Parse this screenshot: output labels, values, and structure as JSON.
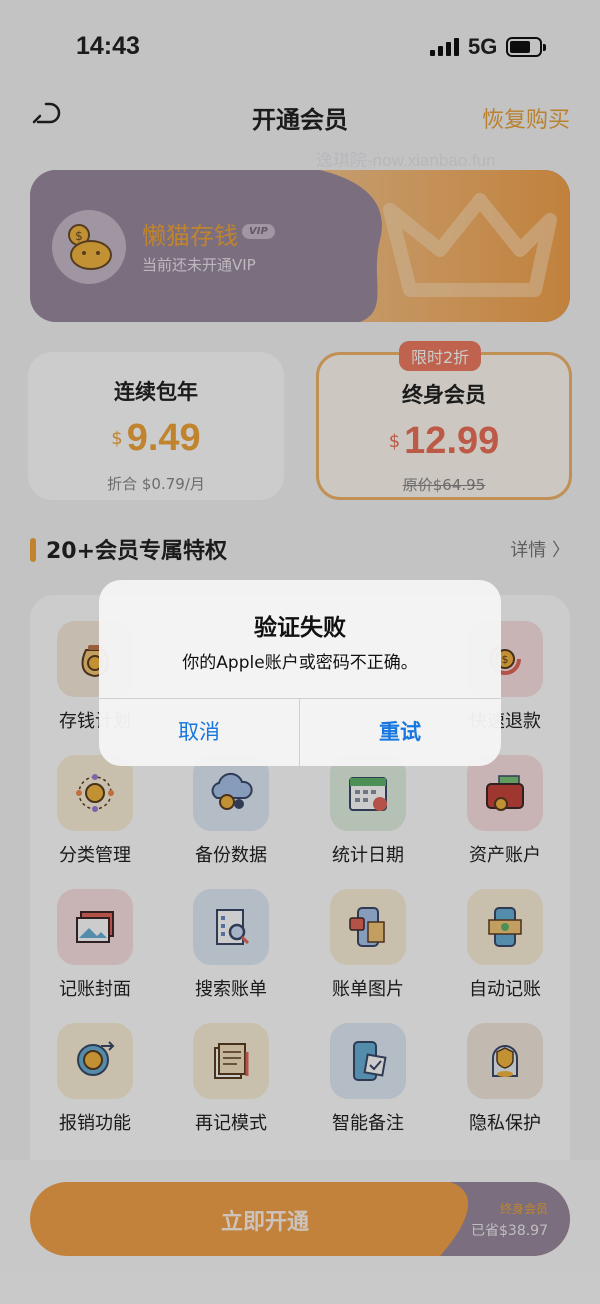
{
  "status_bar": {
    "time": "14:43",
    "network": "5G"
  },
  "nav": {
    "title": "开通会员",
    "restore": "恢复购买"
  },
  "watermark": "逸琪院-now.xianbao.fun",
  "profile": {
    "name": "懒猫存钱",
    "vip_tag": "VIP",
    "status": "当前还未开通VIP"
  },
  "plans": {
    "yearly": {
      "name": "连续包年",
      "currency": "$",
      "price": "9.49",
      "note": "折合 $0.79/月"
    },
    "lifetime": {
      "badge": "限时2折",
      "name": "终身会员",
      "currency": "$",
      "price": "12.99",
      "original": "原价$64.95"
    }
  },
  "privileges": {
    "title": "20+会员专属特权",
    "more": "详情 〉",
    "items": [
      {
        "label": "存钱计划",
        "icon": "coin-bag-icon",
        "bg": "#f7eadb"
      },
      {
        "label": "",
        "icon": "",
        "bg": ""
      },
      {
        "label": "",
        "icon": "",
        "bg": ""
      },
      {
        "label": "快速退款",
        "icon": "refund-coin-icon",
        "bg": "#fbe1e1"
      },
      {
        "label": "分类管理",
        "icon": "category-coin-icon",
        "bg": "#fbf0d7"
      },
      {
        "label": "备份数据",
        "icon": "cloud-backup-icon",
        "bg": "#e1ebf7"
      },
      {
        "label": "统计日期",
        "icon": "calendar-chart-icon",
        "bg": "#e3f2e1"
      },
      {
        "label": "资产账户",
        "icon": "wallet-icon",
        "bg": "#fbe1e1"
      },
      {
        "label": "记账封面",
        "icon": "photo-cover-icon",
        "bg": "#fbe1e1"
      },
      {
        "label": "搜索账单",
        "icon": "search-bill-icon",
        "bg": "#e1ebf7"
      },
      {
        "label": "账单图片",
        "icon": "bill-photo-icon",
        "bg": "#fbf0d7"
      },
      {
        "label": "自动记账",
        "icon": "auto-record-icon",
        "bg": "#fbf0d7"
      },
      {
        "label": "报销功能",
        "icon": "reimburse-icon",
        "bg": "#fbf0d7"
      },
      {
        "label": "再记模式",
        "icon": "notes-icon",
        "bg": "#fbf0d7"
      },
      {
        "label": "智能备注",
        "icon": "smart-note-icon",
        "bg": "#e1ebf7"
      },
      {
        "label": "隐私保护",
        "icon": "privacy-shield-icon",
        "bg": "#f3e8dd"
      }
    ]
  },
  "cta": {
    "label": "立即开通",
    "plan": "终身会员",
    "saved": "已省$38.97"
  },
  "alert": {
    "title": "验证失败",
    "message": "你的Apple账户或密码不正确。",
    "cancel": "取消",
    "retry": "重试"
  },
  "colors": {
    "accent": "#f0a63a",
    "price_red": "#eb7159",
    "link_blue": "#1677e0",
    "profile_purple": "#6b5b70"
  }
}
